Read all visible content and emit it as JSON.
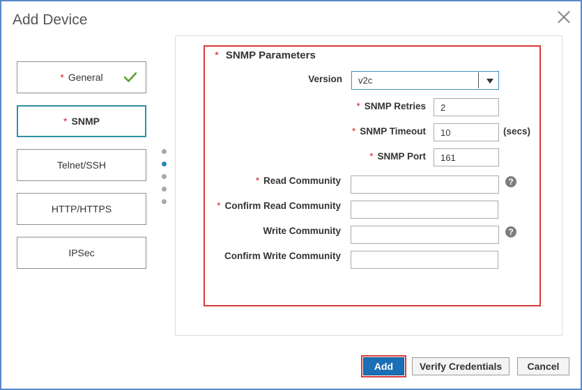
{
  "dialog": {
    "title": "Add Device"
  },
  "sidebar": {
    "items": [
      {
        "label": "General",
        "required": "*",
        "completed": true
      },
      {
        "label": "SNMP",
        "required": "*",
        "active": true
      },
      {
        "label": "Telnet/SSH"
      },
      {
        "label": "HTTP/HTTPS"
      },
      {
        "label": "IPSec"
      }
    ],
    "step_dots": {
      "count": 5,
      "active_index": 1
    }
  },
  "snmp": {
    "section_title": "SNMP Parameters",
    "required_mark": "*",
    "version": {
      "label": "Version",
      "value": "v2c"
    },
    "retries": {
      "label": "SNMP Retries",
      "value": "2"
    },
    "timeout": {
      "label": "SNMP Timeout",
      "value": "10",
      "unit": "(secs)"
    },
    "port": {
      "label": "SNMP Port",
      "value": "161"
    },
    "read_community": {
      "label": "Read Community",
      "value": ""
    },
    "confirm_read_community": {
      "label": "Confirm Read Community",
      "value": ""
    },
    "write_community": {
      "label": "Write Community",
      "value": ""
    },
    "confirm_write_community": {
      "label": "Confirm Write Community",
      "value": ""
    },
    "help_glyph": "?"
  },
  "footer": {
    "add_label": "Add",
    "verify_label": "Verify Credentials",
    "cancel_label": "Cancel"
  },
  "colors": {
    "accent": "#1b70b5",
    "required": "#d9202d",
    "highlight": "#d9393a",
    "check": "#5aa02c",
    "active_tab_border": "#2e8fa3"
  }
}
